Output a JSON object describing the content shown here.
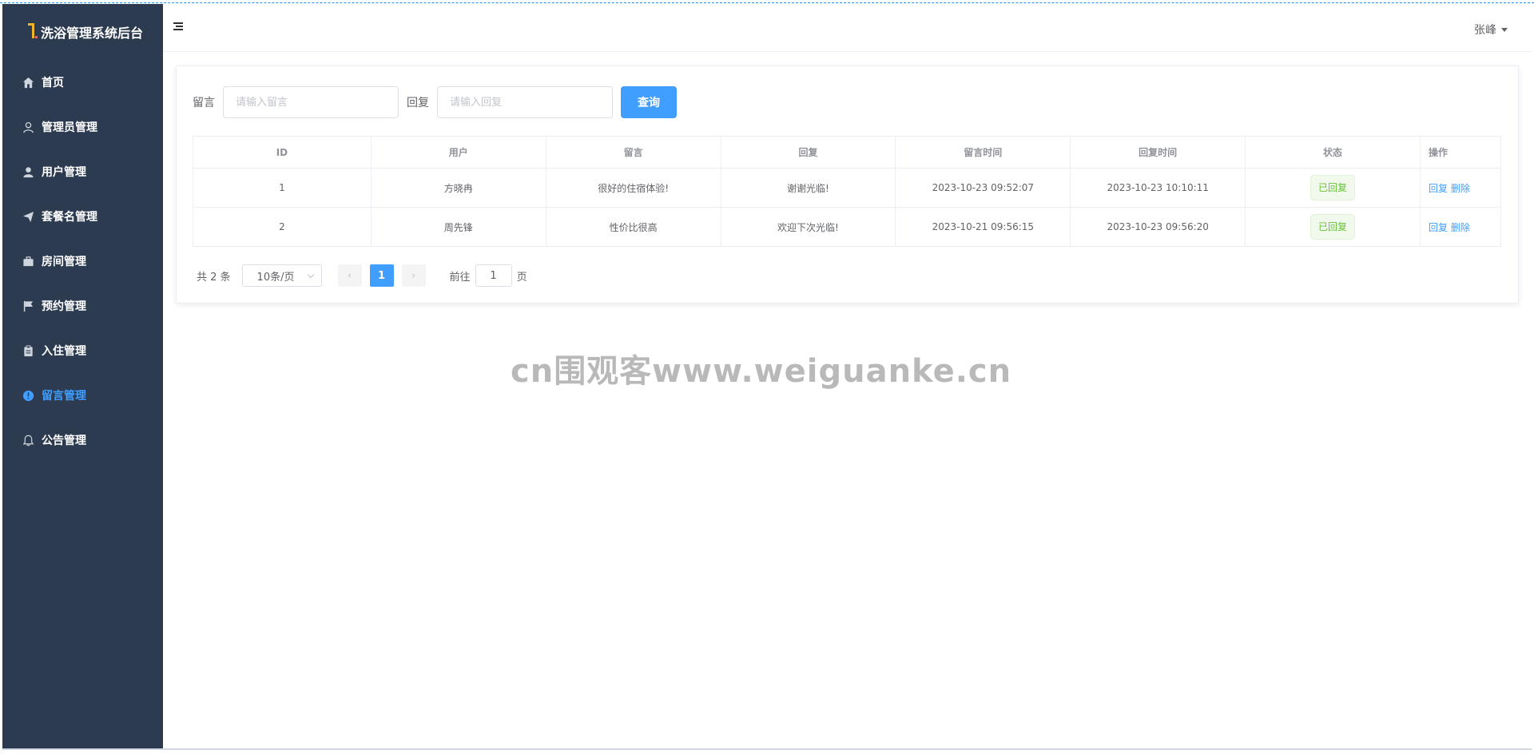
{
  "app": {
    "title": "洗浴管理系统后台"
  },
  "sidebar": {
    "items": [
      {
        "label": "首页",
        "icon": "home-icon",
        "active": false
      },
      {
        "label": "管理员管理",
        "icon": "user-outline-icon",
        "active": false
      },
      {
        "label": "用户管理",
        "icon": "user-solid-icon",
        "active": false
      },
      {
        "label": "套餐名管理",
        "icon": "send-icon",
        "active": false
      },
      {
        "label": "房间管理",
        "icon": "briefcase-icon",
        "active": false
      },
      {
        "label": "预约管理",
        "icon": "flag-icon",
        "active": false
      },
      {
        "label": "入住管理",
        "icon": "clipboard-icon",
        "active": false
      },
      {
        "label": "留言管理",
        "icon": "info-icon",
        "active": true
      },
      {
        "label": "公告管理",
        "icon": "bell-icon",
        "active": false
      }
    ]
  },
  "header": {
    "user_name": "张峰"
  },
  "search": {
    "message_label": "留言",
    "message_placeholder": "请输入留言",
    "reply_label": "回复",
    "reply_placeholder": "请输入回复",
    "query_button": "查询"
  },
  "table": {
    "columns": [
      "ID",
      "用户",
      "留言",
      "回复",
      "留言时间",
      "回复时间",
      "状态",
      "操作"
    ],
    "rows": [
      {
        "id": "1",
        "user": "方晓冉",
        "message": "很好的住宿体验!",
        "reply": "谢谢光临!",
        "message_time": "2023-10-23 09:52:07",
        "reply_time": "2023-10-23 10:10:11",
        "status": "已回复",
        "reply_action": "回复",
        "delete_action": "删除"
      },
      {
        "id": "2",
        "user": "周先锋",
        "message": "性价比很高",
        "reply": "欢迎下次光临!",
        "message_time": "2023-10-21 09:56:15",
        "reply_time": "2023-10-23 09:56:20",
        "status": "已回复",
        "reply_action": "回复",
        "delete_action": "删除"
      }
    ]
  },
  "pagination": {
    "total_text": "共 2 条",
    "page_size": "10条/页",
    "current_page": "1",
    "goto_prefix": "前往",
    "goto_value": "1",
    "goto_suffix": "页"
  },
  "watermark": "cn围观客www.weiguanke.cn",
  "colors": {
    "sidebar_bg": "#2d3b50",
    "accent": "#409eff",
    "success": "#67c23a"
  }
}
